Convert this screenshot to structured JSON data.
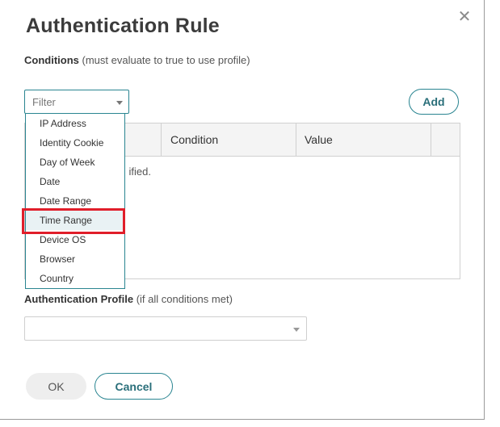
{
  "dialog": {
    "title": "Authentication Rule",
    "close_icon": "close-icon"
  },
  "conditions": {
    "label": "Conditions",
    "hint": "(must evaluate to true to use profile)",
    "filter_placeholder": "Filter",
    "add_label": "Add",
    "columns": [
      "Condition",
      "Value"
    ],
    "empty_message_visible": "ified."
  },
  "dropdown": {
    "options": [
      "IP Address",
      "Identity Cookie",
      "Day of Week",
      "Date",
      "Date Range",
      "Time Range",
      "Device OS",
      "Browser",
      "Country"
    ],
    "highlighted": "Time Range"
  },
  "auth_profile": {
    "label": "Authentication Profile",
    "hint": "(if all conditions met)",
    "selected_value": ""
  },
  "footer": {
    "ok_label": "OK",
    "cancel_label": "Cancel"
  },
  "colors": {
    "accent": "#2a8591",
    "highlight_border": "#e01e2a"
  }
}
